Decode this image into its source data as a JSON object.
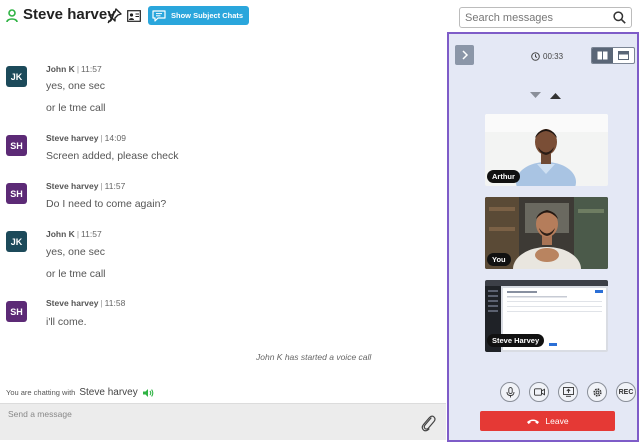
{
  "header": {
    "contact_name": "Steve harvey",
    "subject_chats_label": "Show Subject Chats",
    "search_placeholder": "Search messages"
  },
  "messages": [
    {
      "initials": "JK",
      "sender": "John K",
      "time": "11:57",
      "lines": [
        "yes, one sec",
        "or le tme call"
      ]
    },
    {
      "initials": "SH",
      "sender": "Steve harvey",
      "time": "14:09",
      "lines": [
        "Screen added, please check"
      ]
    },
    {
      "initials": "SH",
      "sender": "Steve harvey",
      "time": "11:57",
      "lines": [
        "Do I need to come again?"
      ]
    },
    {
      "initials": "JK",
      "sender": "John K",
      "time": "11:57",
      "lines": [
        "yes, one sec",
        "or le tme call"
      ]
    },
    {
      "initials": "SH",
      "sender": "Steve harvey",
      "time": "11:58",
      "lines": [
        "i'll come."
      ]
    }
  ],
  "system_note": "John K has started a voice call",
  "footer": {
    "chatting_with_prefix": "You are chatting with",
    "chatting_with_name": "Steve harvey",
    "message_placeholder": "Send a message"
  },
  "call": {
    "timer": "00:33",
    "tiles": [
      {
        "label": "Arthur"
      },
      {
        "label": "You"
      },
      {
        "label": "Steve Harvey"
      }
    ],
    "controls": [
      "microphone-icon",
      "camera-icon",
      "screen-share-icon",
      "settings-icon",
      "record-button"
    ],
    "rec_label": "REC",
    "leave_label": "Leave"
  },
  "colors": {
    "accent": "#2aa6dc",
    "panel_border": "#7e5cc8",
    "leave": "#e53935",
    "jk_avatar": "#1c4a5a",
    "sh_avatar": "#5c2a76",
    "presence": "#2fb344"
  }
}
